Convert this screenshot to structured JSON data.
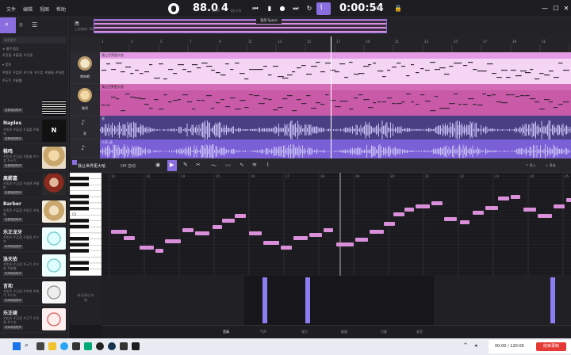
{
  "menu": [
    "文件",
    "编辑",
    "视图",
    "帮助"
  ],
  "transport": {
    "tempo": "88.0",
    "tempo_label": "BPM",
    "beats": "4",
    "beats_label": "拍/小节",
    "time": "0:00:54",
    "time_total": "/ 7:55",
    "tooltip": "暂停 Space"
  },
  "project": {
    "name": "亮",
    "saved": "上次保存: 00:53"
  },
  "left": {
    "search_placeholder": "搜索歌手",
    "section1": "★ 歌手语言",
    "tags1": [
      "#汉语",
      "#英语",
      "#日语"
    ],
    "section2": "▾ 音色",
    "tags2": [
      "#男声",
      "#女声",
      "#少年",
      "#少女",
      "#成熟",
      "#治愈",
      "#元气",
      "#甜美"
    ],
    "singers": [
      {
        "name": "",
        "desc": "",
        "badge": "查看情感歌声"
      },
      {
        "name": "Naples",
        "desc": "#男声 #英语 #温柔 #青年",
        "badge": "查看情感歌声"
      },
      {
        "name": "稚鸣",
        "desc": "#女声 #汉语 #甜美 #少女 #元气",
        "badge": "查看情感歌声"
      },
      {
        "name": "高薪嘉",
        "desc": "#男声 #汉语 #成熟 #磁性",
        "badge": "查看情感歌声"
      },
      {
        "name": "Barber",
        "desc": "#男声 #英语 #低沉 #成熟",
        "badge": "查看情感歌声"
      },
      {
        "name": "乐正龙牙",
        "desc": "#男声 #汉语 #清亮 #少年",
        "badge": "声库情感歌声"
      },
      {
        "name": "洛天依",
        "desc": "#女声 #汉语 #元气 #少女 #甜美",
        "badge": "声库情感歌声"
      },
      {
        "name": "言和",
        "desc": "#女声 #汉语 #中性 #帅气 #少年",
        "badge": "声库情感歌声"
      },
      {
        "name": "乐正绫",
        "desc": "#女声 #汉语 #元气 #活泼 #少女",
        "badge": "声库情感歌声"
      }
    ]
  },
  "tracks": [
    {
      "name": "嘚响嘚",
      "clip": "我让世界更大哈",
      "color": "#e59be5"
    },
    {
      "name": "稚鸣",
      "clip": "我让世界更大哈",
      "color": "#d46bb5"
    },
    {
      "name": "亮",
      "clip": "亮",
      "color": "#8a6ee0"
    },
    {
      "name": "",
      "clip": "人声_亮",
      "color": "#8a6ee0"
    }
  ],
  "ruler": [
    "1",
    "3",
    "5",
    "7",
    "9",
    "11",
    "13",
    "15",
    "17",
    "19",
    "21",
    "23",
    "25",
    "27",
    "29",
    "31",
    "33"
  ],
  "editor": {
    "clip_name": "我让世界更大哈",
    "snap": "Off 自动",
    "import": "↑ 导入",
    "export": "↓ 导出",
    "piano_label": "C5",
    "bars": [
      "12",
      "13",
      "14",
      "15",
      "16",
      "17",
      "18",
      "19",
      "20",
      "21",
      "22",
      "23",
      "24",
      "25"
    ],
    "param_hint": "移动滑动 终端",
    "param_tabs": [
      "音高",
      "气声",
      "张力",
      "能量",
      "力度",
      "发音"
    ]
  },
  "bottom": {
    "time": "00:00 / 120:00",
    "record": "结束录制"
  },
  "colors": {
    "accent": "#8a6ee0",
    "note": "#d98fd9",
    "clip_pink": "#e59be5"
  }
}
